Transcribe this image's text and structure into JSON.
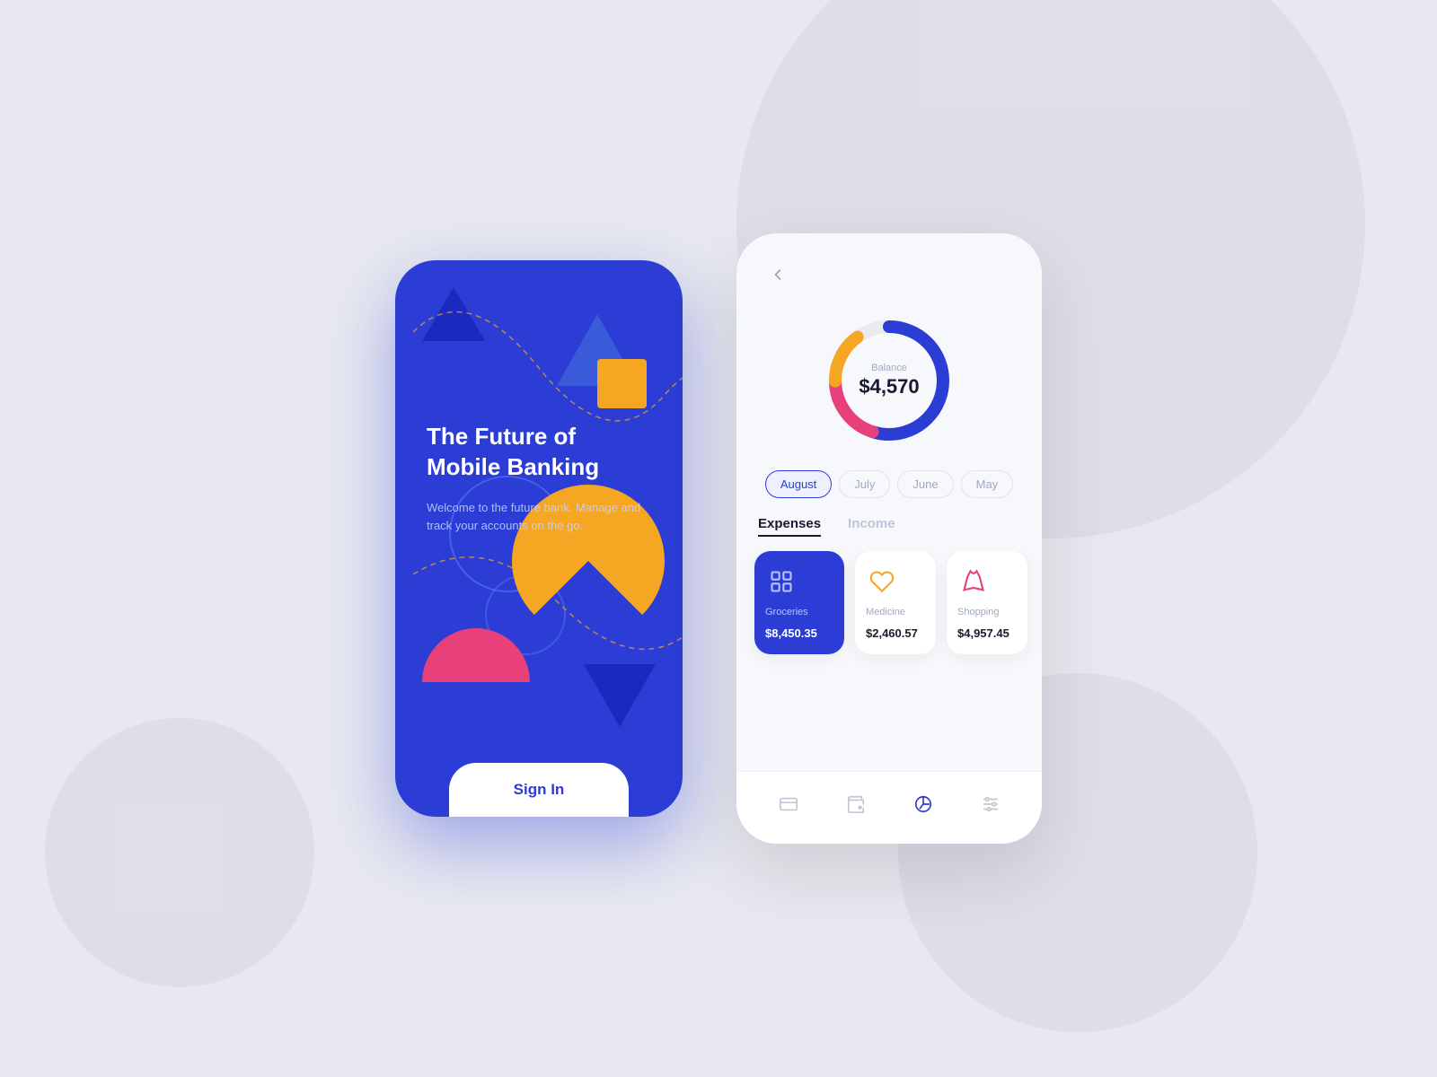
{
  "background": {
    "color": "#e8e9f0"
  },
  "left_phone": {
    "title": "The Future of\nMobile Banking",
    "subtitle": "Welcome to the future bank. Manage\nand track your accounts on the go.",
    "signin_label": "Sign In",
    "bg_color": "#2b3dd4"
  },
  "right_phone": {
    "balance_label": "Balance",
    "balance_amount": "$4,570",
    "months": [
      {
        "label": "August",
        "active": true
      },
      {
        "label": "July",
        "active": false
      },
      {
        "label": "June",
        "active": false
      },
      {
        "label": "May",
        "active": false
      }
    ],
    "section_tabs": [
      {
        "label": "Expenses",
        "active": true
      },
      {
        "label": "Income",
        "active": false
      }
    ],
    "expense_cards": [
      {
        "label": "Groceries",
        "amount": "$8,450.35",
        "icon": "🏪",
        "active": true
      },
      {
        "label": "Medicine",
        "amount": "$2,460.57",
        "icon": "💊",
        "active": false
      },
      {
        "label": "Shopping",
        "amount": "$4,957.45",
        "icon": "👗",
        "active": false
      }
    ],
    "donut": {
      "blue_pct": 55,
      "orange_pct": 15,
      "pink_pct": 20,
      "gray_pct": 10
    },
    "nav_icons": [
      "card",
      "wallet",
      "chart",
      "settings"
    ]
  }
}
